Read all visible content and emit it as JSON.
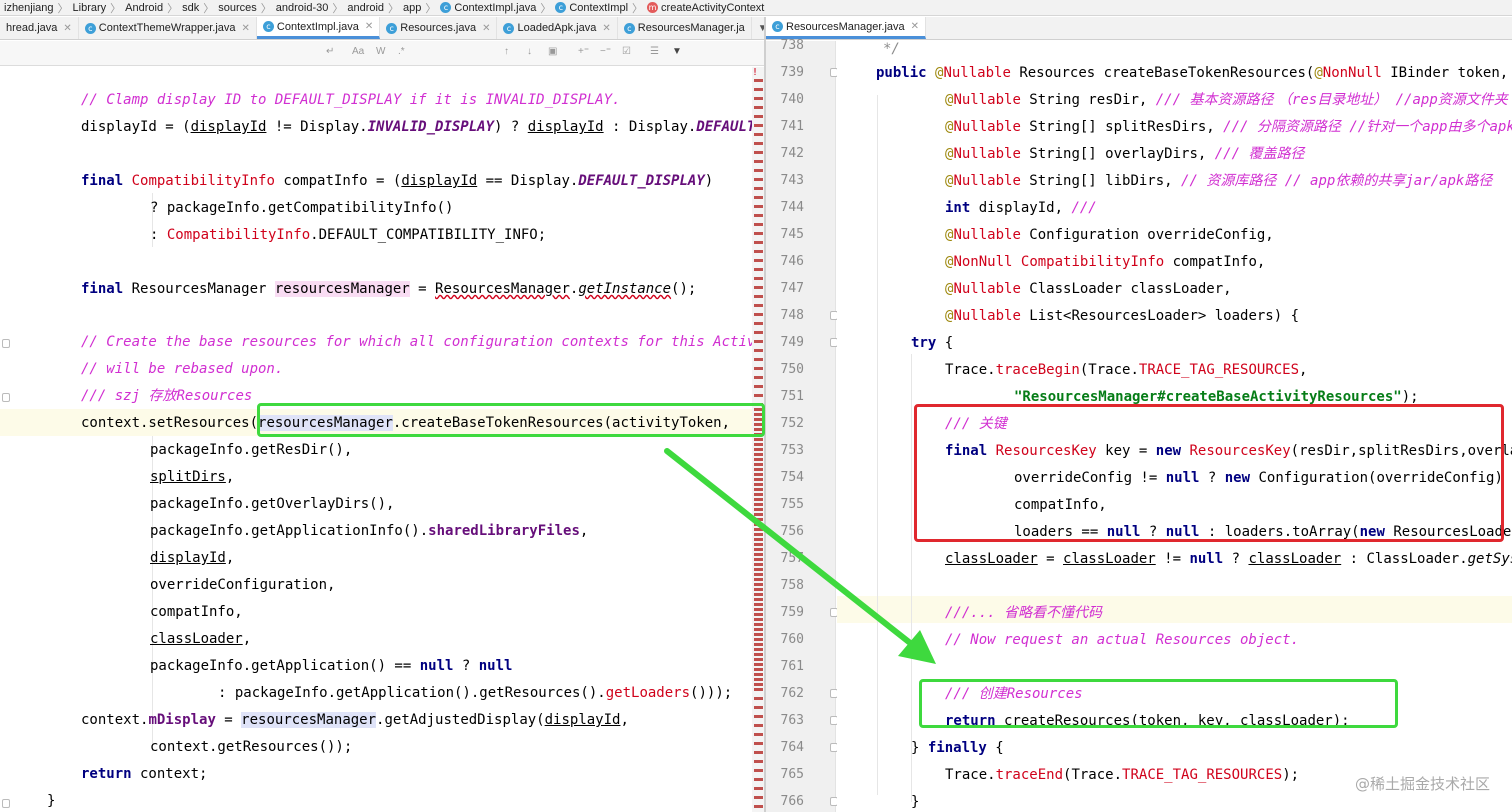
{
  "breadcrumb": [
    "izhenjiang",
    "Library",
    "Android",
    "sdk",
    "sources",
    "android-30",
    "android",
    "app",
    "ContextImpl.java",
    "ContextImpl",
    "createActivityContext"
  ],
  "tabs_left": [
    {
      "label": "hread.java",
      "icon": "none"
    },
    {
      "label": "ContextThemeWrapper.java",
      "icon": "class-c"
    },
    {
      "label": "ContextImpl.java",
      "icon": "class-c"
    },
    {
      "label": "Resources.java",
      "icon": "class-c"
    },
    {
      "label": "LoadedApk.java",
      "icon": "class-c"
    },
    {
      "label": "ResourcesManager.ja",
      "icon": "class-c"
    }
  ],
  "tabs_right": [
    {
      "label": "ResourcesManager.java",
      "icon": "class-c"
    }
  ],
  "findbar": {
    "opt1": "Aa",
    "opt2": "W",
    "opt3": ".*"
  },
  "watermark": "@稀土掘金技术社区",
  "colors": {
    "green_box": "#3ed93e",
    "red_box": "#e0282e",
    "arrow": "#3ed93e"
  }
}
